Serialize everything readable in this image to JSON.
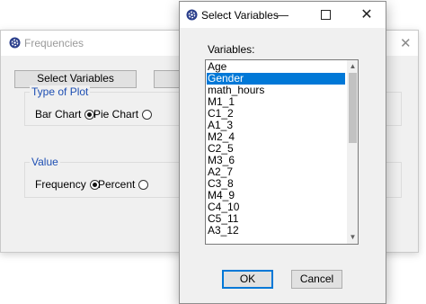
{
  "frequencies": {
    "title": "Frequencies",
    "close": "✕",
    "select_variables_button": "Select Variables",
    "type_of_plot": {
      "legend": "Type of Plot",
      "options": [
        {
          "label": "Bar Chart",
          "selected": true
        },
        {
          "label": "Pie Chart",
          "selected": false
        }
      ]
    },
    "value": {
      "legend": "Value",
      "options": [
        {
          "label": "Frequency",
          "selected": true
        },
        {
          "label": "Percent",
          "selected": false
        }
      ]
    }
  },
  "select_dialog": {
    "title": "Select Variables",
    "minimize": "—",
    "close": "✕",
    "variables_label": "Variables:",
    "variables": [
      "Age",
      "Gender",
      "math_hours",
      "M1_1",
      "C1_2",
      "A1_3",
      "M2_4",
      "C2_5",
      "M3_6",
      "A2_7",
      "C3_8",
      "M4_9",
      "C4_10",
      "C5_11",
      "A3_12"
    ],
    "selected_variable": "Gender",
    "scroll_up": "▲",
    "scroll_down": "▼",
    "ok_button": "OK",
    "cancel_button": "Cancel"
  },
  "colors": {
    "selection": "#0078d7",
    "group_legend": "#1e4fb3",
    "window_bg": "#f0f0f0"
  }
}
